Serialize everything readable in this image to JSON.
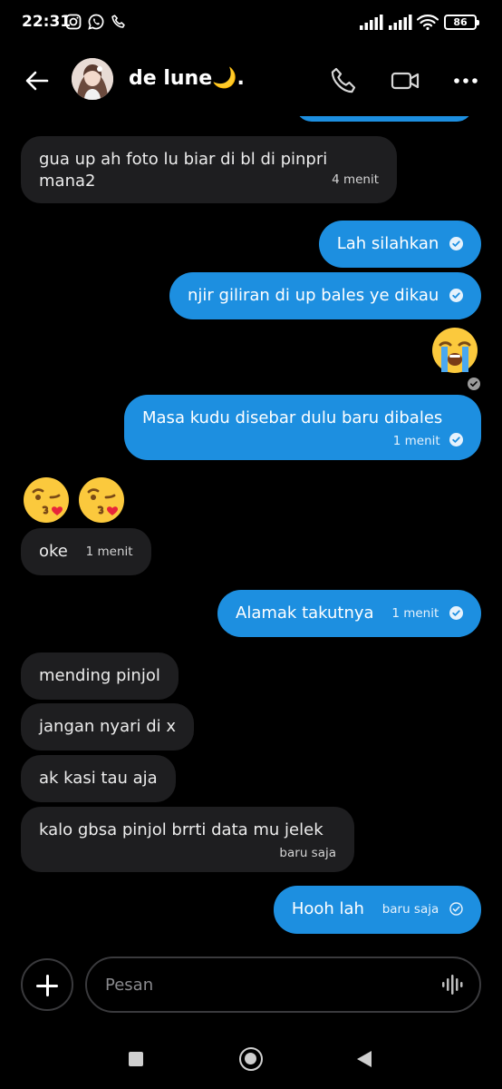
{
  "status_bar": {
    "time": "22:31",
    "battery": "86",
    "icons": [
      "instagram-icon",
      "whatsapp-icon",
      "phone-icon",
      "signal-icon",
      "signal-icon",
      "wifi-icon",
      "battery-icon"
    ]
  },
  "header": {
    "contact_name": "de lune🌙.",
    "icons": [
      "back-arrow-icon",
      "avatar",
      "call-icon",
      "video-call-icon",
      "more-icon"
    ]
  },
  "colors": {
    "background": "#000000",
    "incoming_bubble": "#1e1e20",
    "outgoing_bubble": "#1d8fe0",
    "text": "#ffffff"
  },
  "messages": [
    {
      "direction": "in",
      "text_line1": "gua up ah foto lu biar di bl di pinpri",
      "text_line2": "mana2",
      "time": "4 menit"
    },
    {
      "direction": "out",
      "text": "Lah silahkan",
      "status": "read"
    },
    {
      "direction": "out",
      "text": "njir giliran di up bales ye dikau",
      "status": "read"
    },
    {
      "direction": "out",
      "emoji": "😭",
      "status": "read"
    },
    {
      "direction": "out",
      "text": "Masa kudu disebar dulu baru dibales",
      "time": "1 menit",
      "status": "read"
    },
    {
      "direction": "in",
      "emoji": "😘😘"
    },
    {
      "direction": "in",
      "text": "oke",
      "time": "1 menit"
    },
    {
      "direction": "out",
      "text": "Alamak takutnya",
      "time": "1 menit",
      "status": "read"
    },
    {
      "direction": "in",
      "text": "mending pinjol"
    },
    {
      "direction": "in",
      "text": "jangan nyari di x"
    },
    {
      "direction": "in",
      "text": "ak kasi tau aja"
    },
    {
      "direction": "in",
      "text": "kalo gbsa pinjol brrti data mu jelek",
      "time": "baru saja"
    },
    {
      "direction": "out",
      "text": "Hooh lah",
      "time": "baru saja",
      "status": "sent"
    }
  ],
  "composer": {
    "placeholder": "Pesan",
    "value": ""
  }
}
